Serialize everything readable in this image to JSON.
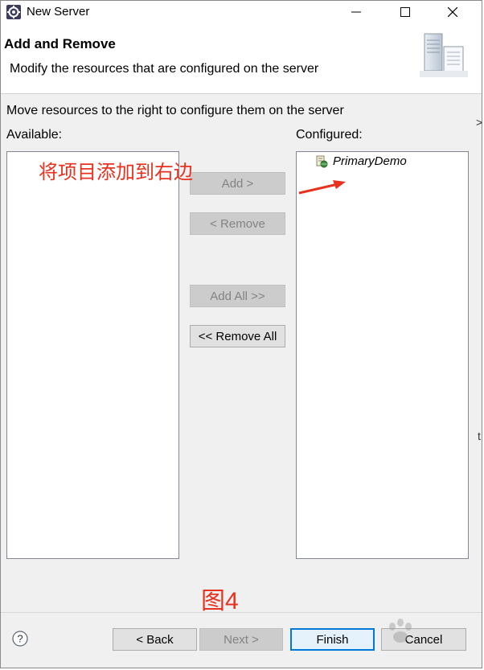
{
  "window": {
    "title": "New Server",
    "icon": "eclipse-gear-icon",
    "controls": [
      "minimize-icon",
      "maximize-icon",
      "close-icon"
    ]
  },
  "header": {
    "title": "Add and Remove",
    "description": "Modify the resources that are configured on the server",
    "image": "server-wizard-icon"
  },
  "body": {
    "instruction": "Move resources to the right to configure them on the server",
    "available_label": "Available:",
    "configured_label": "Configured:",
    "available_items": [],
    "configured_items": [
      {
        "label": "PrimaryDemo",
        "icon": "web-project-icon"
      }
    ]
  },
  "buttons": {
    "add": {
      "label": "Add >",
      "enabled": false
    },
    "remove": {
      "label": "< Remove",
      "enabled": false
    },
    "add_all": {
      "label": "Add All >>",
      "enabled": false
    },
    "remove_all": {
      "label": "<< Remove All",
      "enabled": true
    }
  },
  "footer": {
    "help_icon": "help-icon",
    "back": {
      "label": "< Back",
      "enabled": true
    },
    "next": {
      "label": "Next >",
      "enabled": false
    },
    "finish": {
      "label": "Finish",
      "enabled": true
    },
    "cancel": {
      "label": "Cancel",
      "enabled": true
    }
  },
  "annotations": {
    "instruction_note": "将项目添加到右边",
    "figure_label": "图4",
    "arrow_color": "#e8321f"
  },
  "edge_fragments": {
    "right_top": "\t>",
    "right_mid": "t"
  },
  "colors": {
    "annotation_red": "#e8321f",
    "default_button_border": "#0078d7",
    "dialog_bg": "#f0f0f0"
  }
}
